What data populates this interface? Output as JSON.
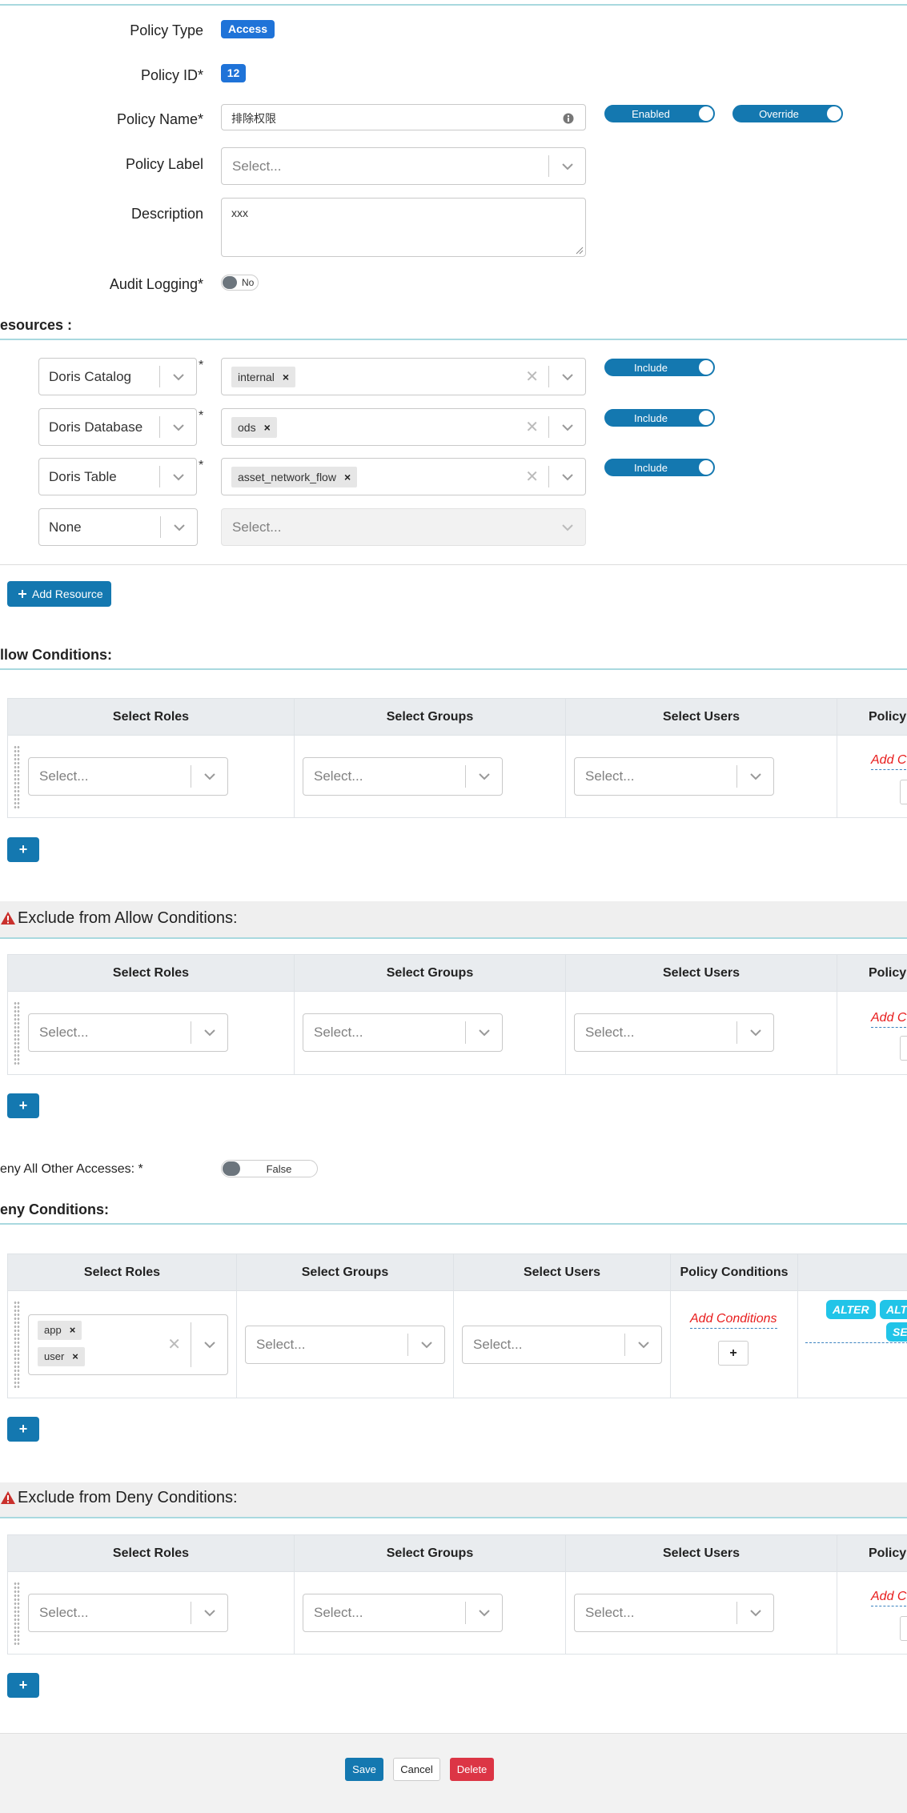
{
  "form": {
    "policy_type_label": "Policy Type",
    "policy_type_value": "Access",
    "policy_id_label": "Policy ID*",
    "policy_id_value": "12",
    "policy_name_label": "Policy Name*",
    "policy_name_value": "排除权限",
    "enabled_toggle": "Enabled",
    "override_toggle": "Override",
    "policy_label_label": "Policy Label",
    "policy_label_placeholder": "Select...",
    "description_label": "Description",
    "description_value": "xxx",
    "audit_logging_label": "Audit Logging*",
    "audit_logging_value": "No"
  },
  "resources": {
    "title": "esources :",
    "rows": [
      {
        "type": "Doris Catalog",
        "value": "internal",
        "toggle": "Include"
      },
      {
        "type": "Doris Database",
        "value": "ods",
        "toggle": "Include"
      },
      {
        "type": "Doris Table",
        "value": "asset_network_flow",
        "toggle": "Include"
      },
      {
        "type": "None",
        "placeholder": "Select..."
      }
    ],
    "required_mark": "*",
    "add_button": "Add Resource"
  },
  "allow": {
    "title": "llow Conditions:",
    "headers": [
      "Select Roles",
      "Select Groups",
      "Select Users",
      "Policy C"
    ],
    "placeholder": "Select...",
    "add_conditions": "Add C",
    "plus": "+"
  },
  "exclude_allow": {
    "title": "Exclude from Allow Conditions:",
    "headers": [
      "Select Roles",
      "Select Groups",
      "Select Users",
      "Policy C"
    ],
    "placeholder": "Select...",
    "add_conditions": "Add C",
    "plus": "+"
  },
  "deny_all": {
    "label": "eny All Other Accesses: *",
    "value": "False"
  },
  "deny": {
    "title": "eny Conditions:",
    "headers": [
      "Select Roles",
      "Select Groups",
      "Select Users",
      "Policy Conditions"
    ],
    "roles": [
      "app",
      "user"
    ],
    "placeholder": "Select...",
    "add_conditions": "Add Conditions",
    "plus_box": "+",
    "perms": [
      "ALTER",
      "ALT",
      "SE"
    ],
    "plus": "+"
  },
  "exclude_deny": {
    "title": "Exclude from Deny Conditions:",
    "headers": [
      "Select Roles",
      "Select Groups",
      "Select Users",
      "Policy C"
    ],
    "placeholder": "Select...",
    "add_conditions": "Add C",
    "plus": "+"
  },
  "footer": {
    "save": "Save",
    "cancel": "Cancel",
    "delete": "Delete"
  },
  "colors": {
    "primary": "#1478b0",
    "badge": "#1f73d8",
    "danger": "#dc3545",
    "add_conditions": "#e81d1d",
    "perm_pill": "#21c4e8",
    "warning": "#c9302c"
  }
}
